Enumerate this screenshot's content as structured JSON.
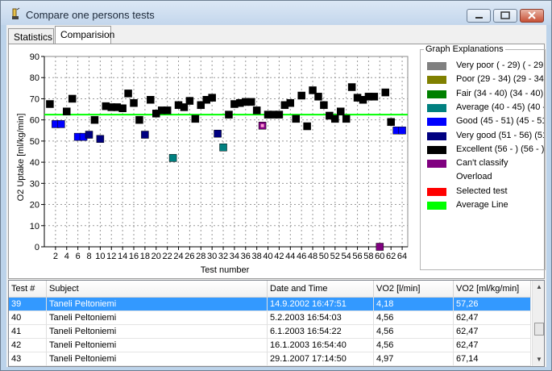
{
  "window": {
    "title": "Compare one persons tests"
  },
  "tabs": [
    {
      "label": "Statistics"
    },
    {
      "label": "Comparision"
    }
  ],
  "chart_data": {
    "type": "scatter",
    "xlabel": "Test number",
    "ylabel": "O2 Uptake [ml/kg/min]",
    "ylim": [
      0,
      90
    ],
    "yticks": [
      0,
      10,
      20,
      30,
      40,
      50,
      60,
      70,
      80,
      90
    ],
    "xticks": [
      2,
      4,
      6,
      8,
      10,
      12,
      14,
      16,
      18,
      20,
      22,
      24,
      26,
      28,
      30,
      32,
      34,
      36,
      38,
      40,
      42,
      44,
      46,
      48,
      50,
      52,
      54,
      56,
      58,
      60,
      62,
      64
    ],
    "xlim": [
      0,
      65
    ],
    "grid": true,
    "average_line": 62.5,
    "points": [
      [
        1,
        67.5,
        "excellent"
      ],
      [
        2,
        58,
        "good"
      ],
      [
        3,
        58,
        "good"
      ],
      [
        4,
        64,
        "excellent"
      ],
      [
        5,
        70,
        "excellent"
      ],
      [
        6,
        52,
        "good"
      ],
      [
        7,
        52,
        "good"
      ],
      [
        8,
        53,
        "verygood"
      ],
      [
        9,
        60,
        "excellent"
      ],
      [
        10,
        51,
        "verygood"
      ],
      [
        11,
        66.5,
        "excellent"
      ],
      [
        12,
        66,
        "excellent"
      ],
      [
        13,
        66,
        "excellent"
      ],
      [
        14,
        65.5,
        "excellent"
      ],
      [
        15,
        72.5,
        "excellent"
      ],
      [
        16,
        68,
        "excellent"
      ],
      [
        17,
        60,
        "excellent"
      ],
      [
        18,
        53,
        "verygood"
      ],
      [
        19,
        69.5,
        "excellent"
      ],
      [
        20,
        63,
        "excellent"
      ],
      [
        21,
        64.5,
        "excellent"
      ],
      [
        22,
        64.5,
        "excellent"
      ],
      [
        23,
        42,
        "average"
      ],
      [
        24,
        67,
        "excellent"
      ],
      [
        25,
        66,
        "excellent"
      ],
      [
        26,
        69,
        "excellent"
      ],
      [
        27,
        60.5,
        "excellent"
      ],
      [
        28,
        67,
        "excellent"
      ],
      [
        29,
        69.5,
        "excellent"
      ],
      [
        30,
        70.5,
        "excellent"
      ],
      [
        31,
        53.5,
        "verygood"
      ],
      [
        32,
        47,
        "average"
      ],
      [
        33,
        62.5,
        "excellent"
      ],
      [
        34,
        67.5,
        "excellent"
      ],
      [
        35,
        68,
        "excellent"
      ],
      [
        36,
        68.5,
        "excellent"
      ],
      [
        37,
        68.5,
        "excellent"
      ],
      [
        38,
        64.5,
        "excellent"
      ],
      [
        39,
        57.3,
        "selected"
      ],
      [
        40,
        62.5,
        "excellent"
      ],
      [
        41,
        62.5,
        "excellent"
      ],
      [
        42,
        62.5,
        "excellent"
      ],
      [
        43,
        67,
        "excellent"
      ],
      [
        44,
        68,
        "excellent"
      ],
      [
        45,
        60.5,
        "excellent"
      ],
      [
        46,
        71.5,
        "excellent"
      ],
      [
        47,
        57,
        "excellent"
      ],
      [
        48,
        74,
        "excellent"
      ],
      [
        49,
        71,
        "excellent"
      ],
      [
        50,
        67,
        "excellent"
      ],
      [
        51,
        62,
        "excellent"
      ],
      [
        52,
        60.5,
        "excellent"
      ],
      [
        53,
        64,
        "excellent"
      ],
      [
        54,
        60.5,
        "excellent"
      ],
      [
        55,
        75.5,
        "excellent"
      ],
      [
        56,
        70.5,
        "excellent"
      ],
      [
        57,
        69.5,
        "excellent"
      ],
      [
        58,
        71,
        "excellent"
      ],
      [
        59,
        71,
        "excellent"
      ],
      [
        60,
        0,
        "cantclassify"
      ],
      [
        61,
        73,
        "excellent"
      ],
      [
        62,
        59,
        "excellent"
      ],
      [
        63,
        55,
        "good"
      ],
      [
        64,
        55,
        "good"
      ]
    ]
  },
  "category_colors": {
    "excellent": "#000000",
    "good": "#0000ff",
    "verygood": "#000080",
    "average": "#008080",
    "cantclassify": "#800080",
    "selected": "#ff0000",
    "overload": "#ffffff",
    "average_line": "#00ff00"
  },
  "legend": {
    "title": "Graph Explanations",
    "items": [
      {
        "label": "Very poor ( - 29) ( - 29",
        "color": "#808080"
      },
      {
        "label": "Poor (29 - 34) (29 - 34",
        "color": "#808000"
      },
      {
        "label": "Fair (34 - 40) (34 - 40)",
        "color": "#008000"
      },
      {
        "label": "Average (40 - 45) (40 -",
        "color": "#008080"
      },
      {
        "label": "Good (45 - 51) (45 - 51",
        "color": "#0000ff"
      },
      {
        "label": "Very good (51 - 56) (51",
        "color": "#000080"
      },
      {
        "label": "Excellent (56 - ) (56 - )",
        "color": "#000000"
      },
      {
        "label": "Can't classify",
        "color": "#800080"
      },
      {
        "label": "Overload",
        "color": "#ffffff"
      },
      {
        "label": "Selected test",
        "color": "#ff0000"
      },
      {
        "label": "Average Line",
        "color": "#00ff00"
      }
    ]
  },
  "table": {
    "columns": [
      "Test #",
      "Subject",
      "Date and Time",
      "VO2 [l/min]",
      "VO2 [ml/kg/min]"
    ],
    "rows": [
      {
        "cells": [
          "39",
          "Taneli Peltoniemi",
          "14.9.2002  16:47:51",
          "4,18",
          "57,26"
        ],
        "selected": true
      },
      {
        "cells": [
          "40",
          "Taneli Peltoniemi",
          "5.2.2003  16:54:03",
          "4,56",
          "62,47"
        ],
        "selected": false
      },
      {
        "cells": [
          "41",
          "Taneli Peltoniemi",
          "6.1.2003  16:54:22",
          "4,56",
          "62,47"
        ],
        "selected": false
      },
      {
        "cells": [
          "42",
          "Taneli Peltoniemi",
          "16.1.2003  16:54:40",
          "4,56",
          "62,47"
        ],
        "selected": false
      },
      {
        "cells": [
          "43",
          "Taneli Peltoniemi",
          "29.1.2007  17:14:50",
          "4,97",
          "67,14"
        ],
        "selected": false
      }
    ]
  }
}
